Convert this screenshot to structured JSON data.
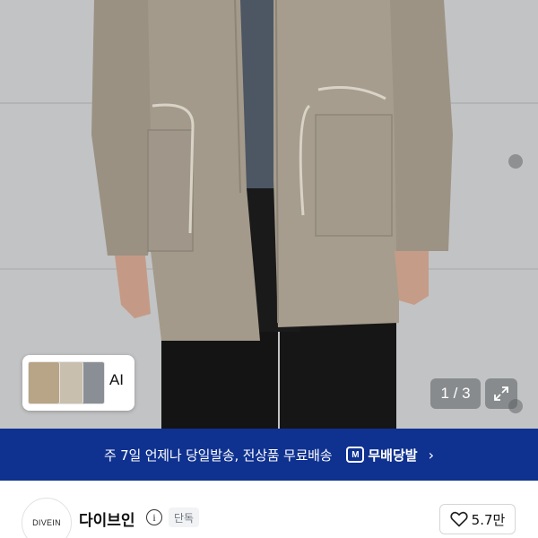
{
  "gallery": {
    "page_current": 1,
    "page_total": 3,
    "counter_text": "1 / 3",
    "ai_label": "AI"
  },
  "banner": {
    "text": "주 7일 언제나 당일발송, 전상품 무료배송",
    "badge_logo": "M",
    "badge_label": "무배당발",
    "chevron": "›",
    "background": "#0f3190"
  },
  "seller": {
    "logo_text": "DIVEIN",
    "name": "다이브인",
    "info_glyph": "i",
    "exclusive_badge": "단독",
    "like_count": "5.7만"
  },
  "icons": [
    "expand-icon",
    "info-icon",
    "heart-icon",
    "chevron-right-icon"
  ]
}
